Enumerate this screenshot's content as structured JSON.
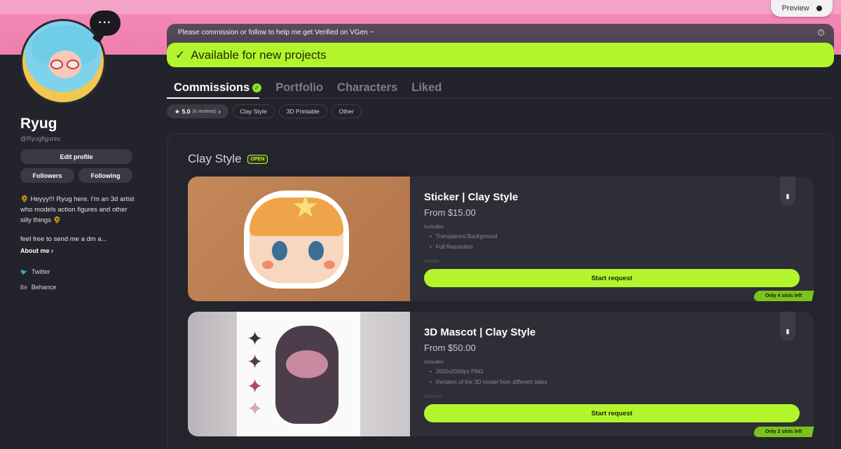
{
  "header": {
    "preview_label": "Preview"
  },
  "profile": {
    "name": "Ryug",
    "handle": "@Ryugfigures",
    "more_label": "···",
    "edit_profile_label": "Edit profile",
    "followers_label": "Followers",
    "following_label": "Following",
    "bio_line": "🌻 Heyyy!!! Ryug here. I'm an 3d artist who models action figures and other silly things 🌻",
    "bio_line2": "feel free to send me a dm a...",
    "about_label": "About me ›",
    "socials": [
      {
        "icon": "twitter-icon",
        "label": "Twitter"
      },
      {
        "icon": "behance-icon",
        "label": "Behance"
      }
    ]
  },
  "notice": {
    "message": "Please commission or follow to help me get Verified on VGen ~",
    "status": "Available for new projects"
  },
  "tabs": [
    {
      "label": "Commissions",
      "active": true
    },
    {
      "label": "Portfolio",
      "active": false
    },
    {
      "label": "Characters",
      "active": false
    },
    {
      "label": "Liked",
      "active": false
    }
  ],
  "filters": {
    "rating": "5.0",
    "reviews": "(6 reviews)",
    "chips": [
      "Clay Style",
      "3D Printable",
      "Other"
    ]
  },
  "section": {
    "title": "Clay Style",
    "badge": "OPEN"
  },
  "commissions": [
    {
      "title": "Sticker | Clay Style",
      "price": "From $15.00",
      "includes_label": "Includes",
      "includes": [
        "Transparent Background",
        "Full Resolution"
      ],
      "more_hint": "Details",
      "cta": "Start request",
      "slots": "Only 4 slots left"
    },
    {
      "title": "3D Mascot | Clay Style",
      "price": "From $50.00",
      "includes_label": "Includes",
      "includes": [
        "2000x2000px PNG",
        "Renders of the 3D model from different sides"
      ],
      "more_hint": "Add-ons",
      "cta": "Start request",
      "slots": "Only 2 slots left"
    }
  ],
  "colors": {
    "accent": "#b3f52c",
    "banner": "#f48ab8",
    "background": "#23232b"
  }
}
